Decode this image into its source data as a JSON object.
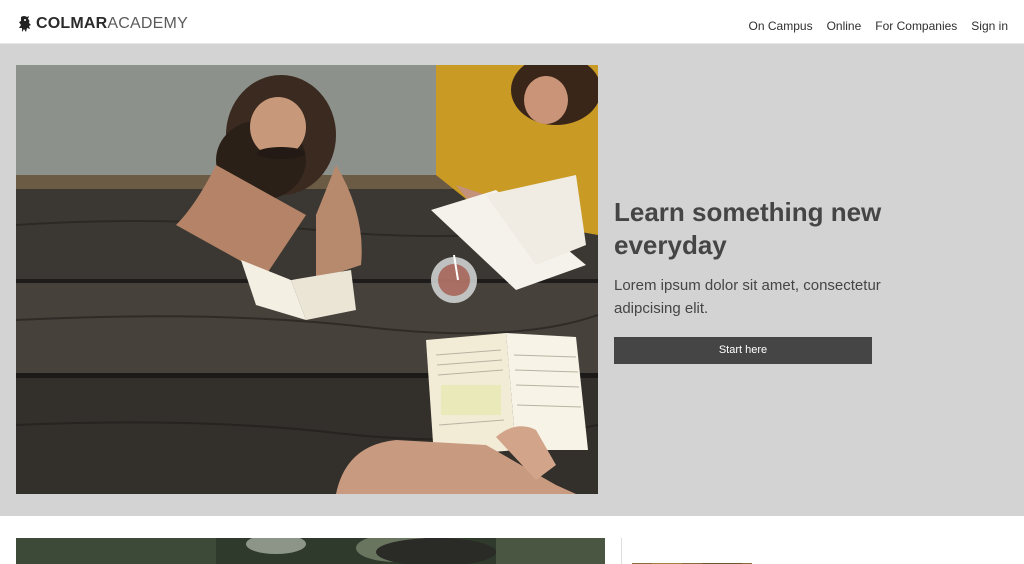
{
  "header": {
    "logo": {
      "bold": "COLMAR",
      "light": "ACADEMY",
      "icon": "lion-icon"
    },
    "nav": [
      {
        "label": "On Campus"
      },
      {
        "label": "Online"
      },
      {
        "label": "For Companies"
      },
      {
        "label": "Sign in"
      }
    ]
  },
  "hero": {
    "title": "Learn something new everyday",
    "subtitle": "Lorem ipsum dolor sit amet, consectetur adipcising elit.",
    "cta_label": "Start here",
    "background_color": "#d3d3d3",
    "button_color": "#454545"
  },
  "colors": {
    "text": "#454545",
    "header_bg": "#ffffff"
  }
}
